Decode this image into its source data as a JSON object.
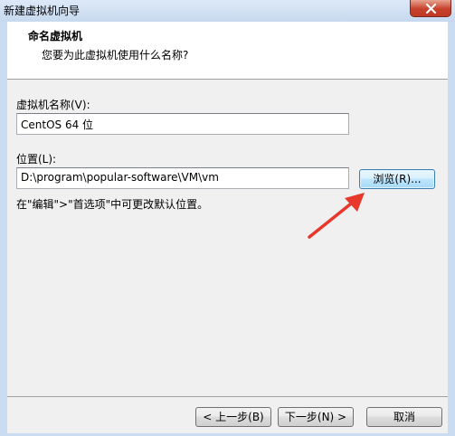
{
  "window": {
    "title": "新建虚拟机向导"
  },
  "header": {
    "title": "命名虚拟机",
    "subtitle": "您要为此虚拟机使用什么名称?"
  },
  "form": {
    "name_label": "虚拟机名称(V):",
    "name_value": "CentOS 64 位",
    "location_label": "位置(L):",
    "location_value": "D:\\program\\popular-software\\VM\\vm",
    "browse_label": "浏览(R)...",
    "hint": "在\"编辑\">\"首选项\"中可更改默认位置。"
  },
  "footer": {
    "back_label": "< 上一步(B)",
    "next_label": "下一步(N) >",
    "cancel_label": "取消"
  },
  "colors": {
    "annotation_arrow": "#e8372b",
    "focus_border": "#3c7fb1"
  },
  "icons": {
    "close": "close-icon",
    "annotation": "red-arrow-annotation"
  }
}
